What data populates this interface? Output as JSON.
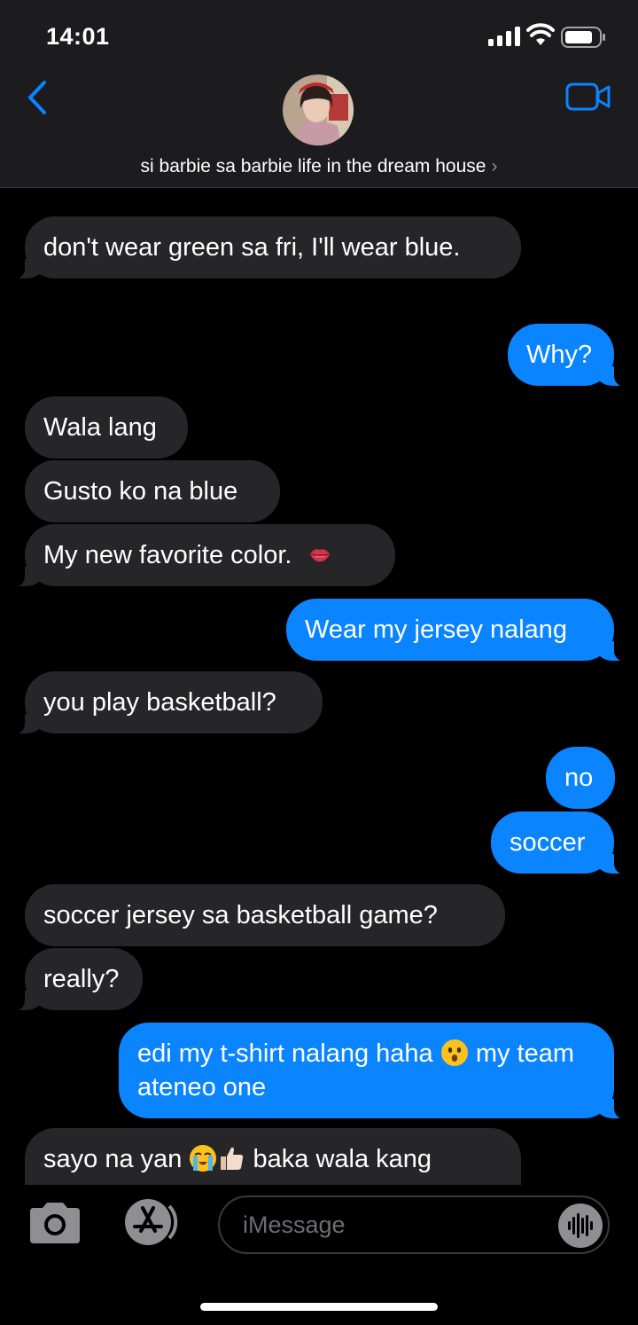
{
  "status_bar": {
    "time": "14:01"
  },
  "header": {
    "contact_name": "si barbie sa barbie life in the dream house",
    "chevron": "›"
  },
  "messages": [
    {
      "from": "them",
      "text": "don't wear green sa fri, I'll wear blue."
    },
    {
      "from": "me",
      "text": "Why?"
    },
    {
      "from": "them",
      "text": "Wala lang"
    },
    {
      "from": "them",
      "text": "Gusto ko na blue"
    },
    {
      "from": "them",
      "text": "My new favorite color.",
      "emoji": "lips-emoji"
    },
    {
      "from": "me",
      "text": "Wear my jersey nalang"
    },
    {
      "from": "them",
      "text": "you play basketball?"
    },
    {
      "from": "me",
      "text": "no"
    },
    {
      "from": "me",
      "text": "soccer"
    },
    {
      "from": "them",
      "text": "soccer jersey sa basketball game?"
    },
    {
      "from": "them",
      "text": "really?"
    },
    {
      "from": "me",
      "text_before": "edi my t-shirt nalang haha",
      "emoji": "hushed-face-emoji",
      "text_after": "my team ateneo one"
    },
    {
      "from": "them",
      "text_before": "sayo na yan",
      "emojis": [
        "loudly-crying-face-emoji",
        "thumbs-up-emoji"
      ],
      "text_after": "baka wala kang"
    }
  ],
  "input": {
    "placeholder": "iMessage"
  },
  "icons": [
    "back-chevron-icon",
    "video-call-icon",
    "camera-icon",
    "app-store-icon",
    "audio-message-icon",
    "signal-icon",
    "wifi-icon",
    "battery-icon"
  ],
  "colors": {
    "incoming_bubble": "#262629",
    "outgoing_bubble": "#0a84ff",
    "accent": "#0a84ff"
  }
}
